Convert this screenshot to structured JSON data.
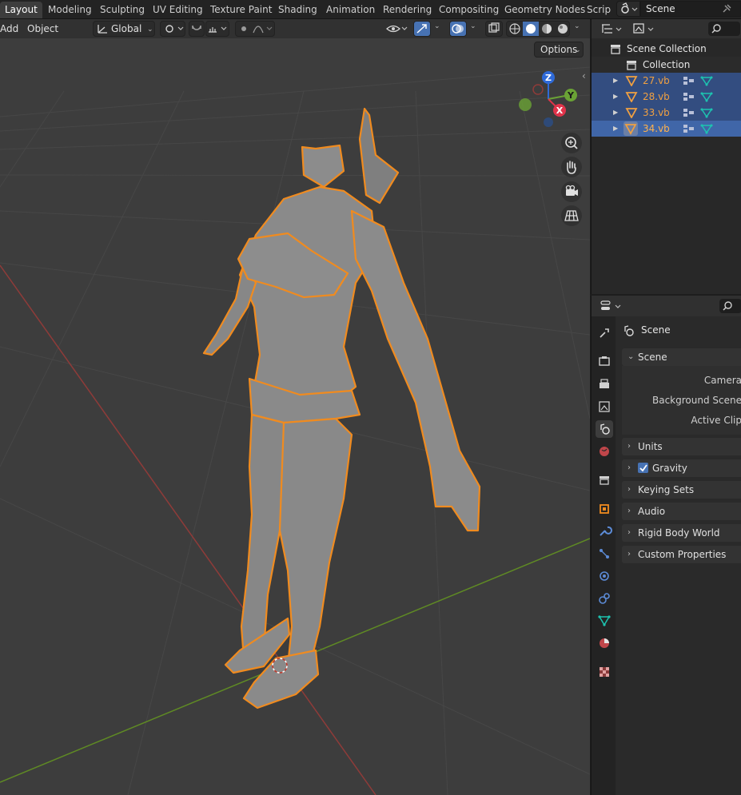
{
  "workspace_tabs": [
    "Layout",
    "Modeling",
    "Sculpting",
    "UV Editing",
    "Texture Paint",
    "Shading",
    "Animation",
    "Rendering",
    "Compositing",
    "Geometry Nodes",
    "Scrip"
  ],
  "scene_name": "Scene",
  "viewport": {
    "menu_add": "Add",
    "menu_object": "Object",
    "orientation": "Global",
    "options": "Options",
    "gizmo": {
      "z": "Z",
      "y": "Y",
      "x": "X"
    }
  },
  "outliner": {
    "root": "Scene Collection",
    "collection": "Collection",
    "objects": [
      "27.vb",
      "28.vb",
      "33.vb",
      "34.vb"
    ]
  },
  "properties": {
    "context": "Scene",
    "scene_panel": "Scene",
    "fields": [
      "Camera",
      "Background Scene",
      "Active Clip"
    ],
    "panels": [
      "Units",
      "Gravity",
      "Keying Sets",
      "Audio",
      "Rigid Body World",
      "Custom Properties"
    ]
  },
  "colors": {
    "selection_outline": "#f08b1f",
    "active_row": "#334d80",
    "grid_x_axis": "#b0413e",
    "grid_y_axis": "#6d9e2a"
  }
}
